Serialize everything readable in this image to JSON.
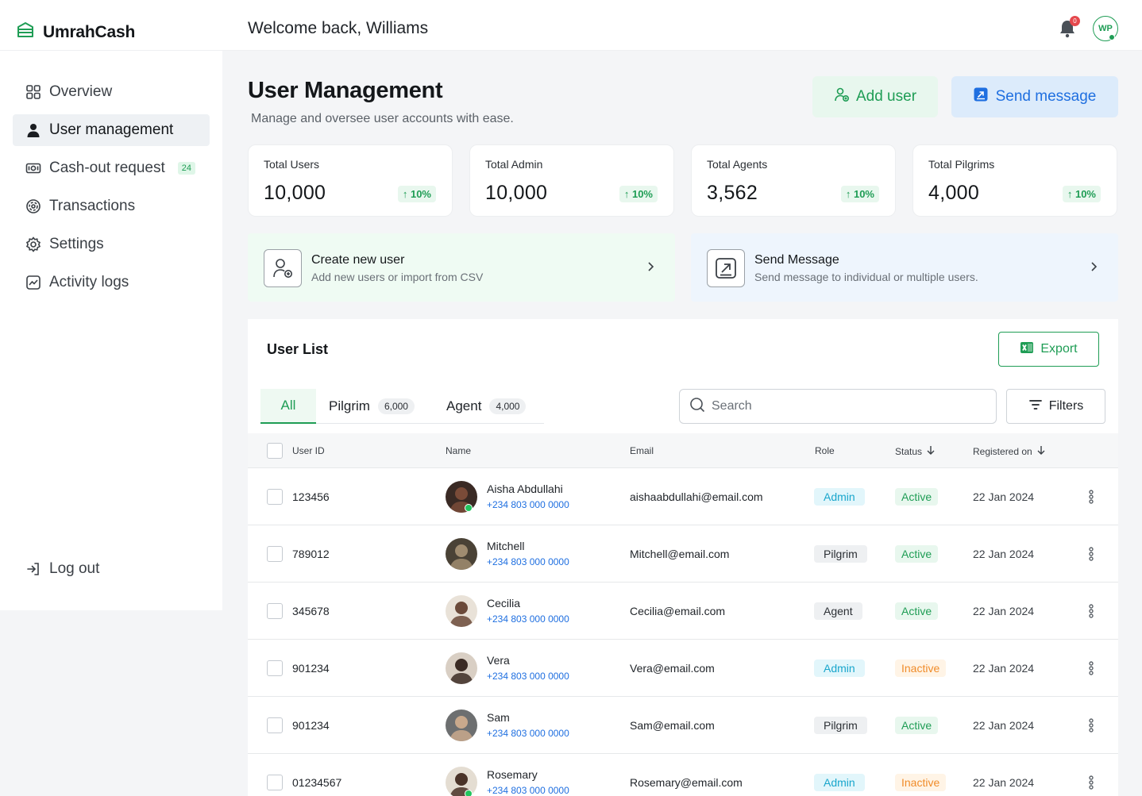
{
  "app": {
    "name": "UmrahCash"
  },
  "header": {
    "welcome": "Welcome back, Williams",
    "notification_count": "0",
    "user_initials": "WP"
  },
  "sidebar": {
    "items": [
      {
        "label": "Overview",
        "icon": "grid-icon"
      },
      {
        "label": "User management",
        "icon": "user-icon",
        "active": true
      },
      {
        "label": "Cash-out request",
        "icon": "cash-icon",
        "badge": "24"
      },
      {
        "label": "Transactions",
        "icon": "transactions-icon"
      },
      {
        "label": "Settings",
        "icon": "gear-icon"
      },
      {
        "label": "Activity logs",
        "icon": "activity-icon"
      }
    ],
    "logout": "Log out"
  },
  "page": {
    "title": "User Management",
    "subtitle": "Manage and oversee user accounts with ease.",
    "add_user": "Add user",
    "send_message": "Send message"
  },
  "stats": [
    {
      "label": "Total Users",
      "value": "10,000",
      "change": "10%"
    },
    {
      "label": "Total Admin",
      "value": "10,000",
      "change": "10%"
    },
    {
      "label": "Total Agents",
      "value": "3,562",
      "change": "10%"
    },
    {
      "label": "Total Pilgrims",
      "value": "4,000",
      "change": "10%"
    }
  ],
  "actions": [
    {
      "title": "Create new user",
      "desc": "Add new users or import from CSV"
    },
    {
      "title": "Send Message",
      "desc": "Send message to individual or multiple users."
    }
  ],
  "user_list": {
    "title": "User List",
    "export": "Export",
    "tabs": [
      {
        "label": "All"
      },
      {
        "label": "Pilgrim",
        "count": "6,000"
      },
      {
        "label": "Agent",
        "count": "4,000"
      }
    ],
    "search_placeholder": "Search",
    "filters": "Filters",
    "columns": [
      "User ID",
      "Name",
      "Email",
      "Role",
      "Status",
      "Registered on"
    ],
    "rows": [
      {
        "id": "123456",
        "name": "Aisha Abdullahi",
        "phone": "+234 803 000 0000",
        "email": "aishaabdullahi@email.com",
        "role": "Admin",
        "status": "Active",
        "date": "22 Jan 2024",
        "online": true
      },
      {
        "id": "789012",
        "name": "Mitchell",
        "phone": "+234 803 000 0000",
        "email": "Mitchell@email.com",
        "role": "Pilgrim",
        "status": "Active",
        "date": "22 Jan 2024",
        "online": false
      },
      {
        "id": "345678",
        "name": "Cecilia",
        "phone": "+234 803 000 0000",
        "email": "Cecilia@email.com",
        "role": "Agent",
        "status": "Active",
        "date": "22 Jan 2024",
        "online": false
      },
      {
        "id": "901234",
        "name": "Vera",
        "phone": "+234 803 000 0000",
        "email": "Vera@email.com",
        "role": "Admin",
        "status": "Inactive",
        "date": "22 Jan 2024",
        "online": false
      },
      {
        "id": "901234",
        "name": "Sam",
        "phone": "+234 803 000 0000",
        "email": "Sam@email.com",
        "role": "Pilgrim",
        "status": "Active",
        "date": "22 Jan 2024",
        "online": false
      },
      {
        "id": "01234567",
        "name": "Rosemary",
        "phone": "+234 803 000 0000",
        "email": "Rosemary@email.com",
        "role": "Admin",
        "status": "Inactive",
        "date": "22 Jan 2024",
        "online": true
      }
    ]
  },
  "colors": {
    "brand_green": "#1f9d55",
    "brand_blue": "#1f6fe0",
    "admin_cyan": "#19a6cc",
    "inactive_orange": "#f08c2a"
  }
}
